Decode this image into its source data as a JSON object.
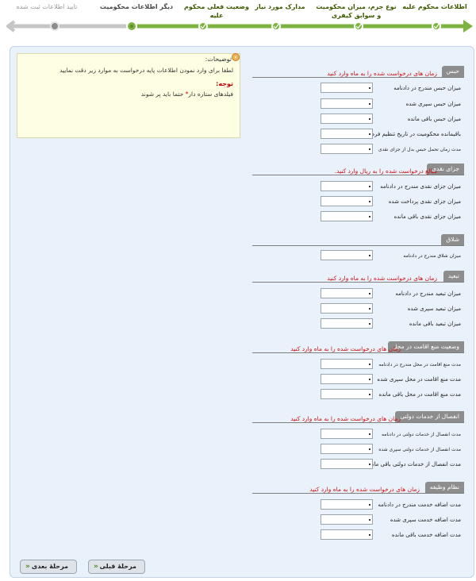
{
  "wizard": {
    "steps": [
      {
        "label": "اطلاعات محکوم علیه",
        "state": "done"
      },
      {
        "label": "نوع جرم، میزان محکومیت و سوابق کیفری",
        "state": "done"
      },
      {
        "label": "مدارک مورد نیاز",
        "state": "done"
      },
      {
        "label": "وضعیت فعلی محکوم علیه",
        "state": "done"
      },
      {
        "label": "دیگر اطلاعات محکومیت",
        "state": "current"
      },
      {
        "label": "تایید اطلاعات ثبت شده",
        "state": "todo"
      }
    ]
  },
  "notes": {
    "title": "توضیحات:",
    "line1": "لطفا برای وارد نمودن اطلاعات پایه درخواست به موارد زیر دقت نمایید",
    "attention": "توجه:",
    "line2_a": "فیلدهای ستاره دار",
    "star": "*",
    "line2_b": "حتما باید پر شوند"
  },
  "sections": [
    {
      "tab": "حبس",
      "hint": "زمان های درخواست شده را به ماه وارد کنید",
      "fields": [
        {
          "label": "میزان حبس مندرج در دادنامه",
          "small": false
        },
        {
          "label": "میزان حبس سپری شده",
          "small": false
        },
        {
          "label": "میزان حبس باقی مانده",
          "small": false
        },
        {
          "label": "باقیمانده محکومیت در تاریخ تنظیم فرم",
          "small": false
        },
        {
          "label": "مدت زمان تحمل حبس بدل از جزای نقدی",
          "small": true
        }
      ]
    },
    {
      "tab": "جزای نقدی",
      "hint": "مبالغ درخواست شده را به ریال وارد کنید.",
      "fields": [
        {
          "label": "میزان جزای نقدی مندرج در دادنامه",
          "small": false
        },
        {
          "label": "میزان جزای نقدی پرداخت شده",
          "small": false
        },
        {
          "label": "میزان جزای نقدی باقی مانده",
          "small": false
        }
      ]
    },
    {
      "tab": "شلاق",
      "hint": "",
      "fields": [
        {
          "label": "میزان شلاق مندرج در دادنامه",
          "small": true
        }
      ]
    },
    {
      "tab": "تبعید",
      "hint": "زمان های درخواست شده را به ماه وارد کنید",
      "fields": [
        {
          "label": "میزان تبعید مندرج در دادنامه",
          "small": false
        },
        {
          "label": "میزان تبعید سپری شده",
          "small": false
        },
        {
          "label": "میزان تبعید باقی مانده",
          "small": false
        }
      ]
    },
    {
      "tab": "وضعیت منع اقامت در محل",
      "hint": "زمان های درخواست شده را به ماه وارد کنید",
      "fields": [
        {
          "label": "مدت منع اقامت در محل مندرج در دادنامه",
          "small": true
        },
        {
          "label": "مدت منع اقامت در محل سپری شده",
          "small": false
        },
        {
          "label": "مدت منع اقامت در محل باقی مانده",
          "small": false
        }
      ]
    },
    {
      "tab": "انفصال از خدمات دولتی",
      "hint": "زمان های درخواست شده را به ماه وارد کنید",
      "fields": [
        {
          "label": "مدت انفصال از خدمات دولتی در دادنامه",
          "small": true
        },
        {
          "label": "مدت انفصال از خدمات دولتی سپری شده",
          "small": true
        },
        {
          "label": "مدت انفصال از خدمات دولتی باقی مانده",
          "small": false
        }
      ]
    },
    {
      "tab": "نظام وظیفه",
      "hint": "زمان های درخواست شده را به ماه وارد کنید",
      "fields": [
        {
          "label": "مدت اضافه خدمت مندرج در دادنامه",
          "small": false
        },
        {
          "label": "مدت اضافه خدمت سپری شده",
          "small": false
        },
        {
          "label": "مدت اضافه خدمت باقی مانده",
          "small": false
        }
      ]
    }
  ],
  "buttons": {
    "prev": "مرحلهٔ قبلی",
    "next": "مرحلهٔ بعدی",
    "arrow": "«"
  },
  "colors": {
    "done": "#7cb341",
    "todo": "#c6c6c6"
  }
}
